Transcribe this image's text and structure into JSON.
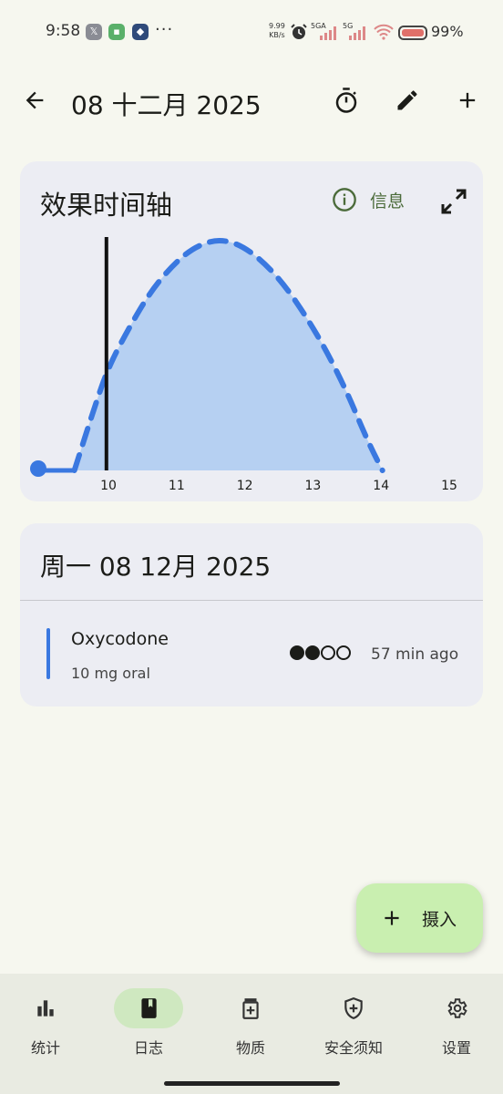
{
  "status_bar": {
    "time": "9:58",
    "dots": "···",
    "net_speed": "9.99",
    "net_unit": "KB/s",
    "sim1": "5GA",
    "sim2": "5G",
    "battery": "99%"
  },
  "header": {
    "title": "08 十二月 2025",
    "back_icon": "arrow-left-icon",
    "actions": [
      "timer-icon",
      "edit-icon",
      "add-icon"
    ]
  },
  "effect_card": {
    "title": "效果时间轴",
    "info_label": "信息",
    "expand_icon": "expand-icon"
  },
  "chart_data": {
    "type": "area",
    "x_ticks": [
      "10",
      "11",
      "12",
      "13",
      "14",
      "15"
    ],
    "xlim": [
      8.97,
      15.0
    ],
    "now_marker": 9.97,
    "onset_start": 8.97,
    "onset_end": 9.5,
    "curve_x": [
      9.5,
      9.8,
      10.0,
      10.3,
      10.6,
      10.9,
      11.2,
      11.5,
      11.75,
      12.0,
      12.3,
      12.6,
      12.9,
      13.2,
      13.5,
      13.7,
      13.85,
      14.02
    ],
    "curve_y": [
      0.0,
      0.28,
      0.45,
      0.62,
      0.77,
      0.88,
      0.96,
      1.0,
      1.0,
      0.97,
      0.9,
      0.8,
      0.67,
      0.52,
      0.34,
      0.2,
      0.1,
      0.0
    ],
    "fill_color": "#b6d0f2",
    "line_color": "#3a78e0"
  },
  "day_card": {
    "title": "周一 08 12月 2025",
    "ingestions": [
      {
        "substance": "Oxycodone",
        "dose": "10 mg oral",
        "dots_filled": 2,
        "dots_total": 4,
        "time_ago": "57 min ago",
        "color": "#3a78e0"
      }
    ]
  },
  "fab": {
    "label": "摄入",
    "icon": "plus-icon"
  },
  "bottom_nav": {
    "items": [
      {
        "label": "统计",
        "icon": "bar-chart-icon"
      },
      {
        "label": "日志",
        "icon": "journal-icon"
      },
      {
        "label": "物质",
        "icon": "medicine-icon"
      },
      {
        "label": "安全须知",
        "icon": "shield-icon"
      },
      {
        "label": "设置",
        "icon": "gear-icon"
      }
    ],
    "active_index": 1
  }
}
